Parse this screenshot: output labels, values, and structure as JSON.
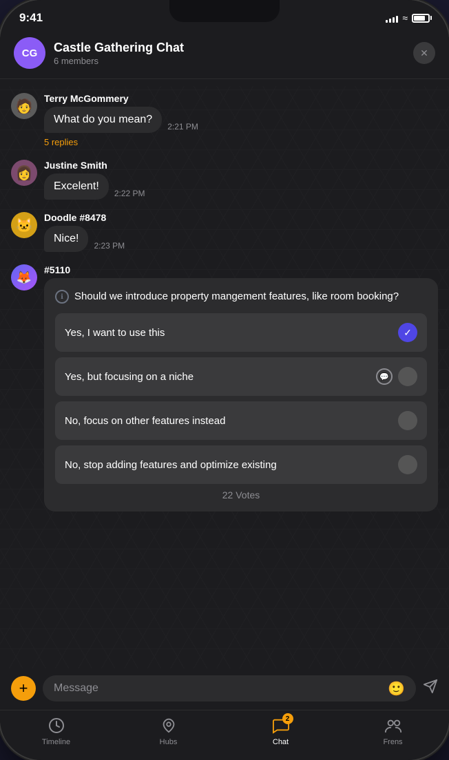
{
  "statusBar": {
    "time": "9:41",
    "signalBars": [
      4,
      6,
      8,
      10,
      12
    ],
    "batteryLevel": 80
  },
  "header": {
    "avatarText": "CG",
    "title": "Castle Gathering Chat",
    "subtitle": "6 members",
    "closeLabel": "×"
  },
  "messages": [
    {
      "id": "msg1",
      "sender": "Terry McGommery",
      "avatarEmoji": "👨",
      "bubble": "What do you mean?",
      "time": "2:21 PM",
      "replies": "5 replies"
    },
    {
      "id": "msg2",
      "sender": "Justine Smith",
      "avatarEmoji": "👩",
      "bubble": "Excelent!",
      "time": "2:22 PM",
      "replies": null
    },
    {
      "id": "msg3",
      "sender": "Doodle #8478",
      "avatarEmoji": "🐱",
      "bubble": "Nice!",
      "time": "2:23 PM",
      "replies": null
    },
    {
      "id": "msg4",
      "sender": "#5110",
      "avatarEmoji": "🦊",
      "bubble": null,
      "time": null,
      "replies": null
    }
  ],
  "poll": {
    "question": "Should we introduce property mangement features, like room booking?",
    "options": [
      {
        "text": "Yes, I want to use this",
        "state": "checked"
      },
      {
        "text": "Yes, but focusing on a niche",
        "state": "chat"
      },
      {
        "text": "No, focus on other features instead",
        "state": "empty"
      },
      {
        "text": "No, stop adding features and optimize existing",
        "state": "empty"
      }
    ],
    "votes": "22 Votes"
  },
  "inputBar": {
    "placeholder": "Message",
    "plusLabel": "+",
    "emojiLabel": "🙂"
  },
  "bottomNav": [
    {
      "id": "timeline",
      "label": "Timeline",
      "iconType": "clock",
      "active": false,
      "badge": null
    },
    {
      "id": "hubs",
      "label": "Hubs",
      "iconType": "hubs",
      "active": false,
      "badge": null
    },
    {
      "id": "chat",
      "label": "Chat",
      "iconType": "chat",
      "active": true,
      "badge": "2"
    },
    {
      "id": "frens",
      "label": "Frens",
      "iconType": "frens",
      "active": false,
      "badge": null
    }
  ]
}
